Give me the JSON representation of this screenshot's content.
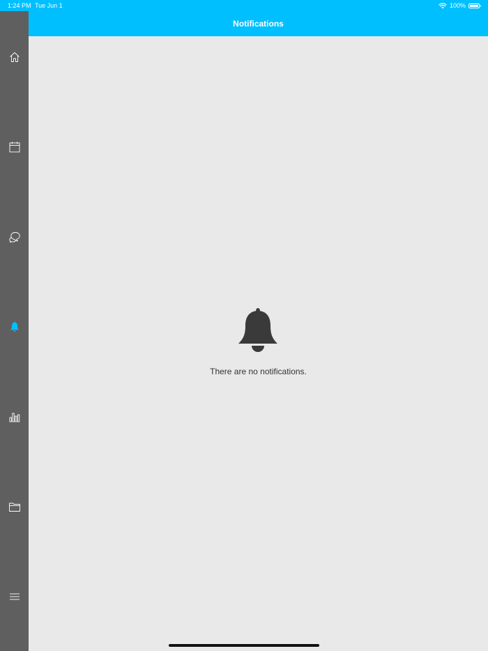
{
  "status_bar": {
    "time": "1:24 PM",
    "date": "Tue Jun 1",
    "battery": "100%",
    "battery_level": 1.0
  },
  "header": {
    "title": "Notifications"
  },
  "sidebar": {
    "items": [
      {
        "name": "home",
        "icon": "home-icon",
        "active": false
      },
      {
        "name": "calendar",
        "icon": "calendar-icon",
        "active": false
      },
      {
        "name": "messages",
        "icon": "chat-bubbles-icon",
        "active": false
      },
      {
        "name": "notifications",
        "icon": "bell-icon",
        "active": true
      },
      {
        "name": "reports",
        "icon": "bar-chart-icon",
        "active": false
      },
      {
        "name": "files",
        "icon": "folder-icon",
        "active": false
      },
      {
        "name": "menu",
        "icon": "hamburger-menu-icon",
        "active": false
      }
    ]
  },
  "main": {
    "empty_state": {
      "icon": "bell-icon",
      "message": "There are no notifications."
    }
  },
  "colors": {
    "accent": "#00bfff",
    "sidebar_bg": "#5f5f5f",
    "content_bg": "#e9e9e9",
    "icon_inactive": "#ffffff",
    "icon_active": "#00bfff",
    "empty_icon": "#3a3a3a"
  }
}
